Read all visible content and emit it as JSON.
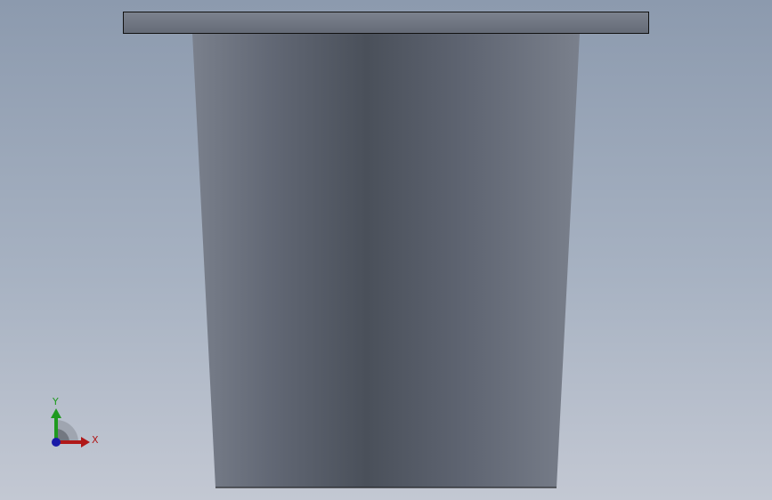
{
  "viewport": {
    "background_top": "#8c9aae",
    "background_bottom": "#c3c8d3"
  },
  "model": {
    "flange_fill": "#6d7380",
    "body_shade_dark": "#4a505a",
    "body_shade_light": "#7a808c",
    "edge_color": "#111111"
  },
  "triad": {
    "x_label": "X",
    "y_label": "Y",
    "x_color": "#b01818",
    "y_color": "#1f9a1f",
    "z_color": "#1a1aa8"
  }
}
